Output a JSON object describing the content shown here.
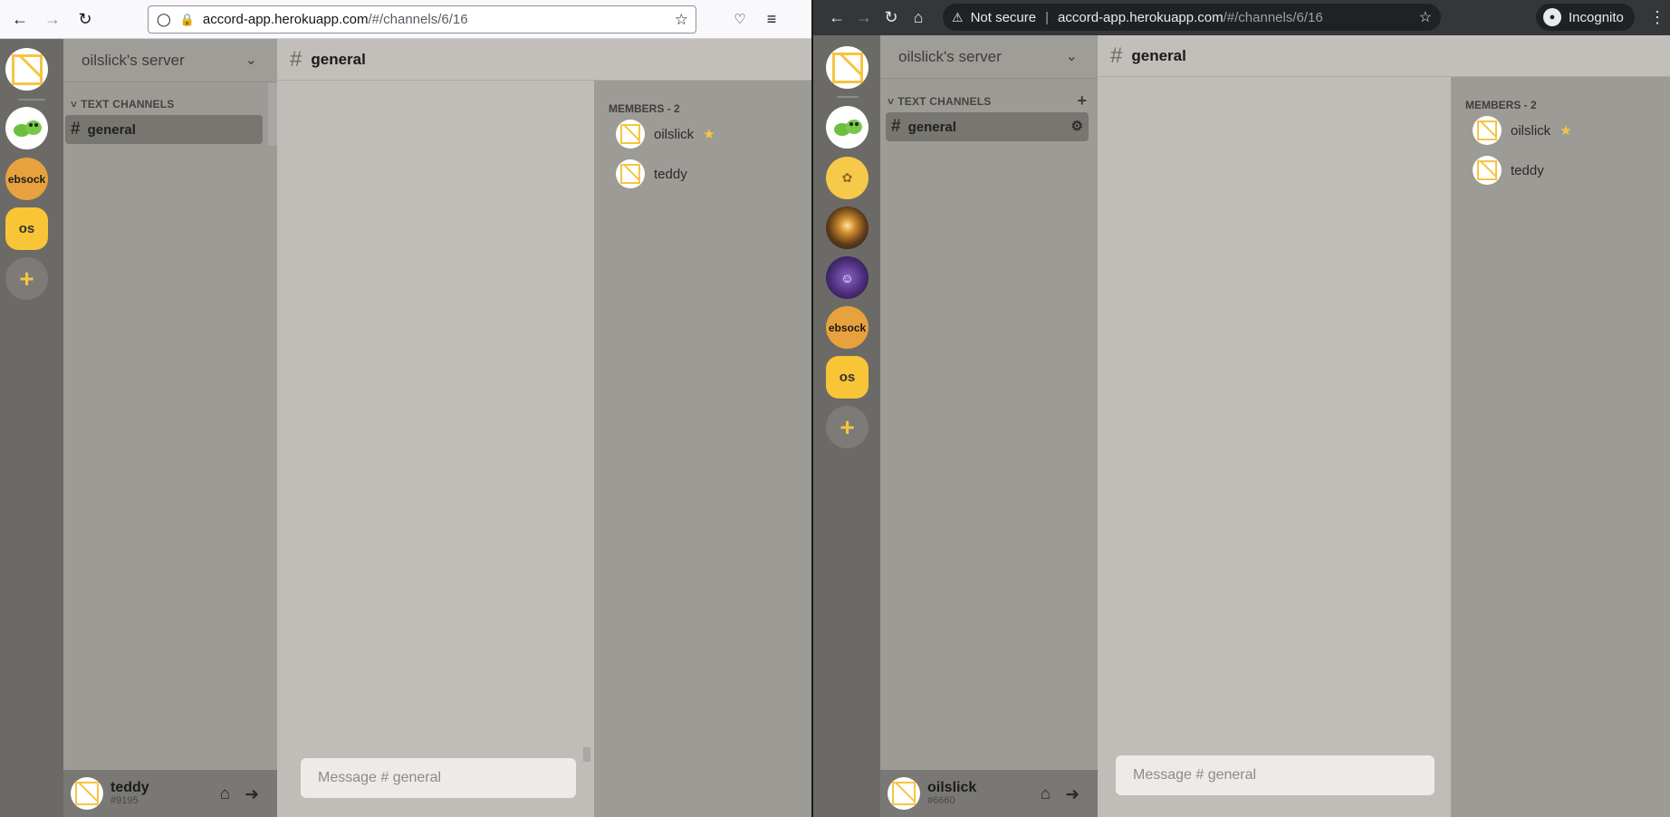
{
  "left_browser": {
    "url_main": "accord-app.herokuapp.com",
    "url_path": "/#/channels/6/16"
  },
  "right_browser": {
    "security_label": "Not secure",
    "url_main": "accord-app.herokuapp.com",
    "url_path": "/#/channels/6/16",
    "incognito_label": "Incognito"
  },
  "left_app": {
    "server_name": "oilslick's server",
    "category": "TEXT CHANNELS",
    "channel": "general",
    "chat_title": "general",
    "message_placeholder": "Message # general",
    "members_header": "MEMBERS - 2",
    "members": [
      {
        "name": "oilslick",
        "owner": true
      },
      {
        "name": "teddy",
        "owner": false
      }
    ],
    "user": {
      "name": "teddy",
      "tag": "#9195"
    },
    "server_labels": {
      "ebs": "ebsock",
      "os": "os"
    }
  },
  "right_app": {
    "server_name": "oilslick's server",
    "category": "TEXT CHANNELS",
    "channel": "general",
    "chat_title": "general",
    "message_placeholder": "Message # general",
    "members_header": "MEMBERS - 2",
    "members": [
      {
        "name": "oilslick",
        "owner": true
      },
      {
        "name": "teddy",
        "owner": false
      }
    ],
    "user": {
      "name": "oilslick",
      "tag": "#6660"
    },
    "server_labels": {
      "ebs": "ebsock",
      "os": "os"
    }
  },
  "colors": {
    "accent": "#f5c542",
    "sidebar": "#6b6a66",
    "channels": "#9d9b96",
    "chat": "#c0bdb8"
  }
}
